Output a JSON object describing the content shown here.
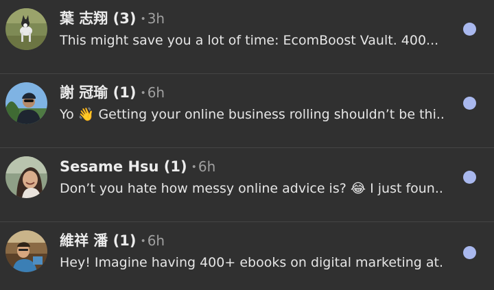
{
  "conversations": [
    {
      "name": "葉 志翔 (3)",
      "separator": "•",
      "time": "3h",
      "preview": "This might save you a lot of time: EcomBoost Vault. 400...",
      "unread": true
    },
    {
      "name": "謝 冠瑜 (1)",
      "separator": "•",
      "time": "6h",
      "preview": "Yo 👋 Getting your online business rolling shouldn’t be thi...",
      "unread": true
    },
    {
      "name": "Sesame Hsu (1)",
      "separator": "•",
      "time": "6h",
      "preview": "Don’t you hate how messy online advice is? 😂 I just foun...",
      "unread": true
    },
    {
      "name": "維祥 潘 (1)",
      "separator": "•",
      "time": "6h",
      "preview": "Hey! Imagine having 400+ ebooks on digital marketing at...",
      "unread": true
    }
  ],
  "colors": {
    "background": "#303030",
    "divider": "#454545",
    "unread_dot": "#a9b8ee",
    "name_text": "#ececec",
    "meta_text": "#a0a0a0"
  }
}
